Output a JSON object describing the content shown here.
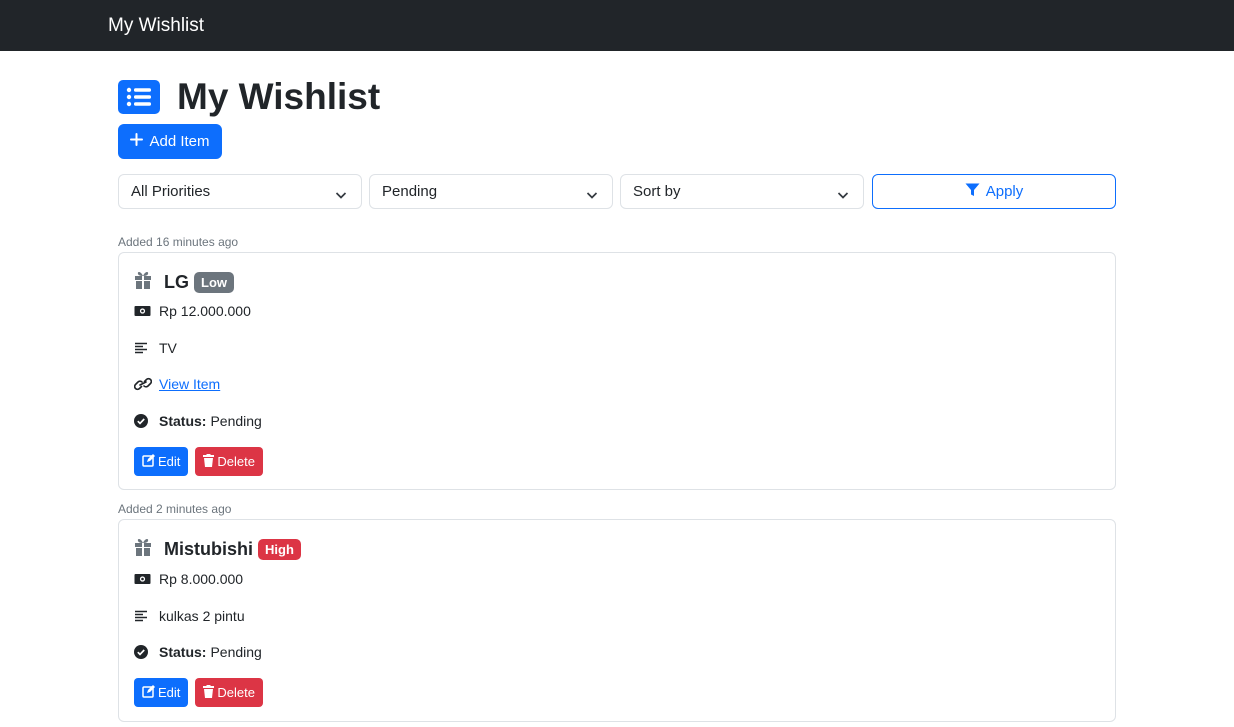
{
  "navbar": {
    "brand": "My Wishlist"
  },
  "page": {
    "title": "My Wishlist",
    "add_button_label": "Add Item"
  },
  "filters": {
    "priority": "All Priorities",
    "status": "Pending",
    "sort": "Sort by",
    "apply_label": "Apply"
  },
  "items": [
    {
      "added": "Added 16 minutes ago",
      "name": "LG",
      "priority": "Low",
      "priority_color": "#6c757d",
      "price": "Rp 12.000.000",
      "description": "TV",
      "link_label": "View Item",
      "status_label": "Status:",
      "status": "Pending",
      "edit_label": "Edit",
      "delete_label": "Delete"
    },
    {
      "added": "Added 2 minutes ago",
      "name": "Mistubishi",
      "priority": "High",
      "priority_color": "#dc3545",
      "price": "Rp 8.000.000",
      "description": "kulkas 2 pintu",
      "status_label": "Status:",
      "status": "Pending",
      "edit_label": "Edit",
      "delete_label": "Delete"
    }
  ],
  "colors": {
    "navbar": "#212529",
    "primary": "#0d6efd",
    "danger": "#dc3545",
    "secondary": "#6c757d"
  }
}
